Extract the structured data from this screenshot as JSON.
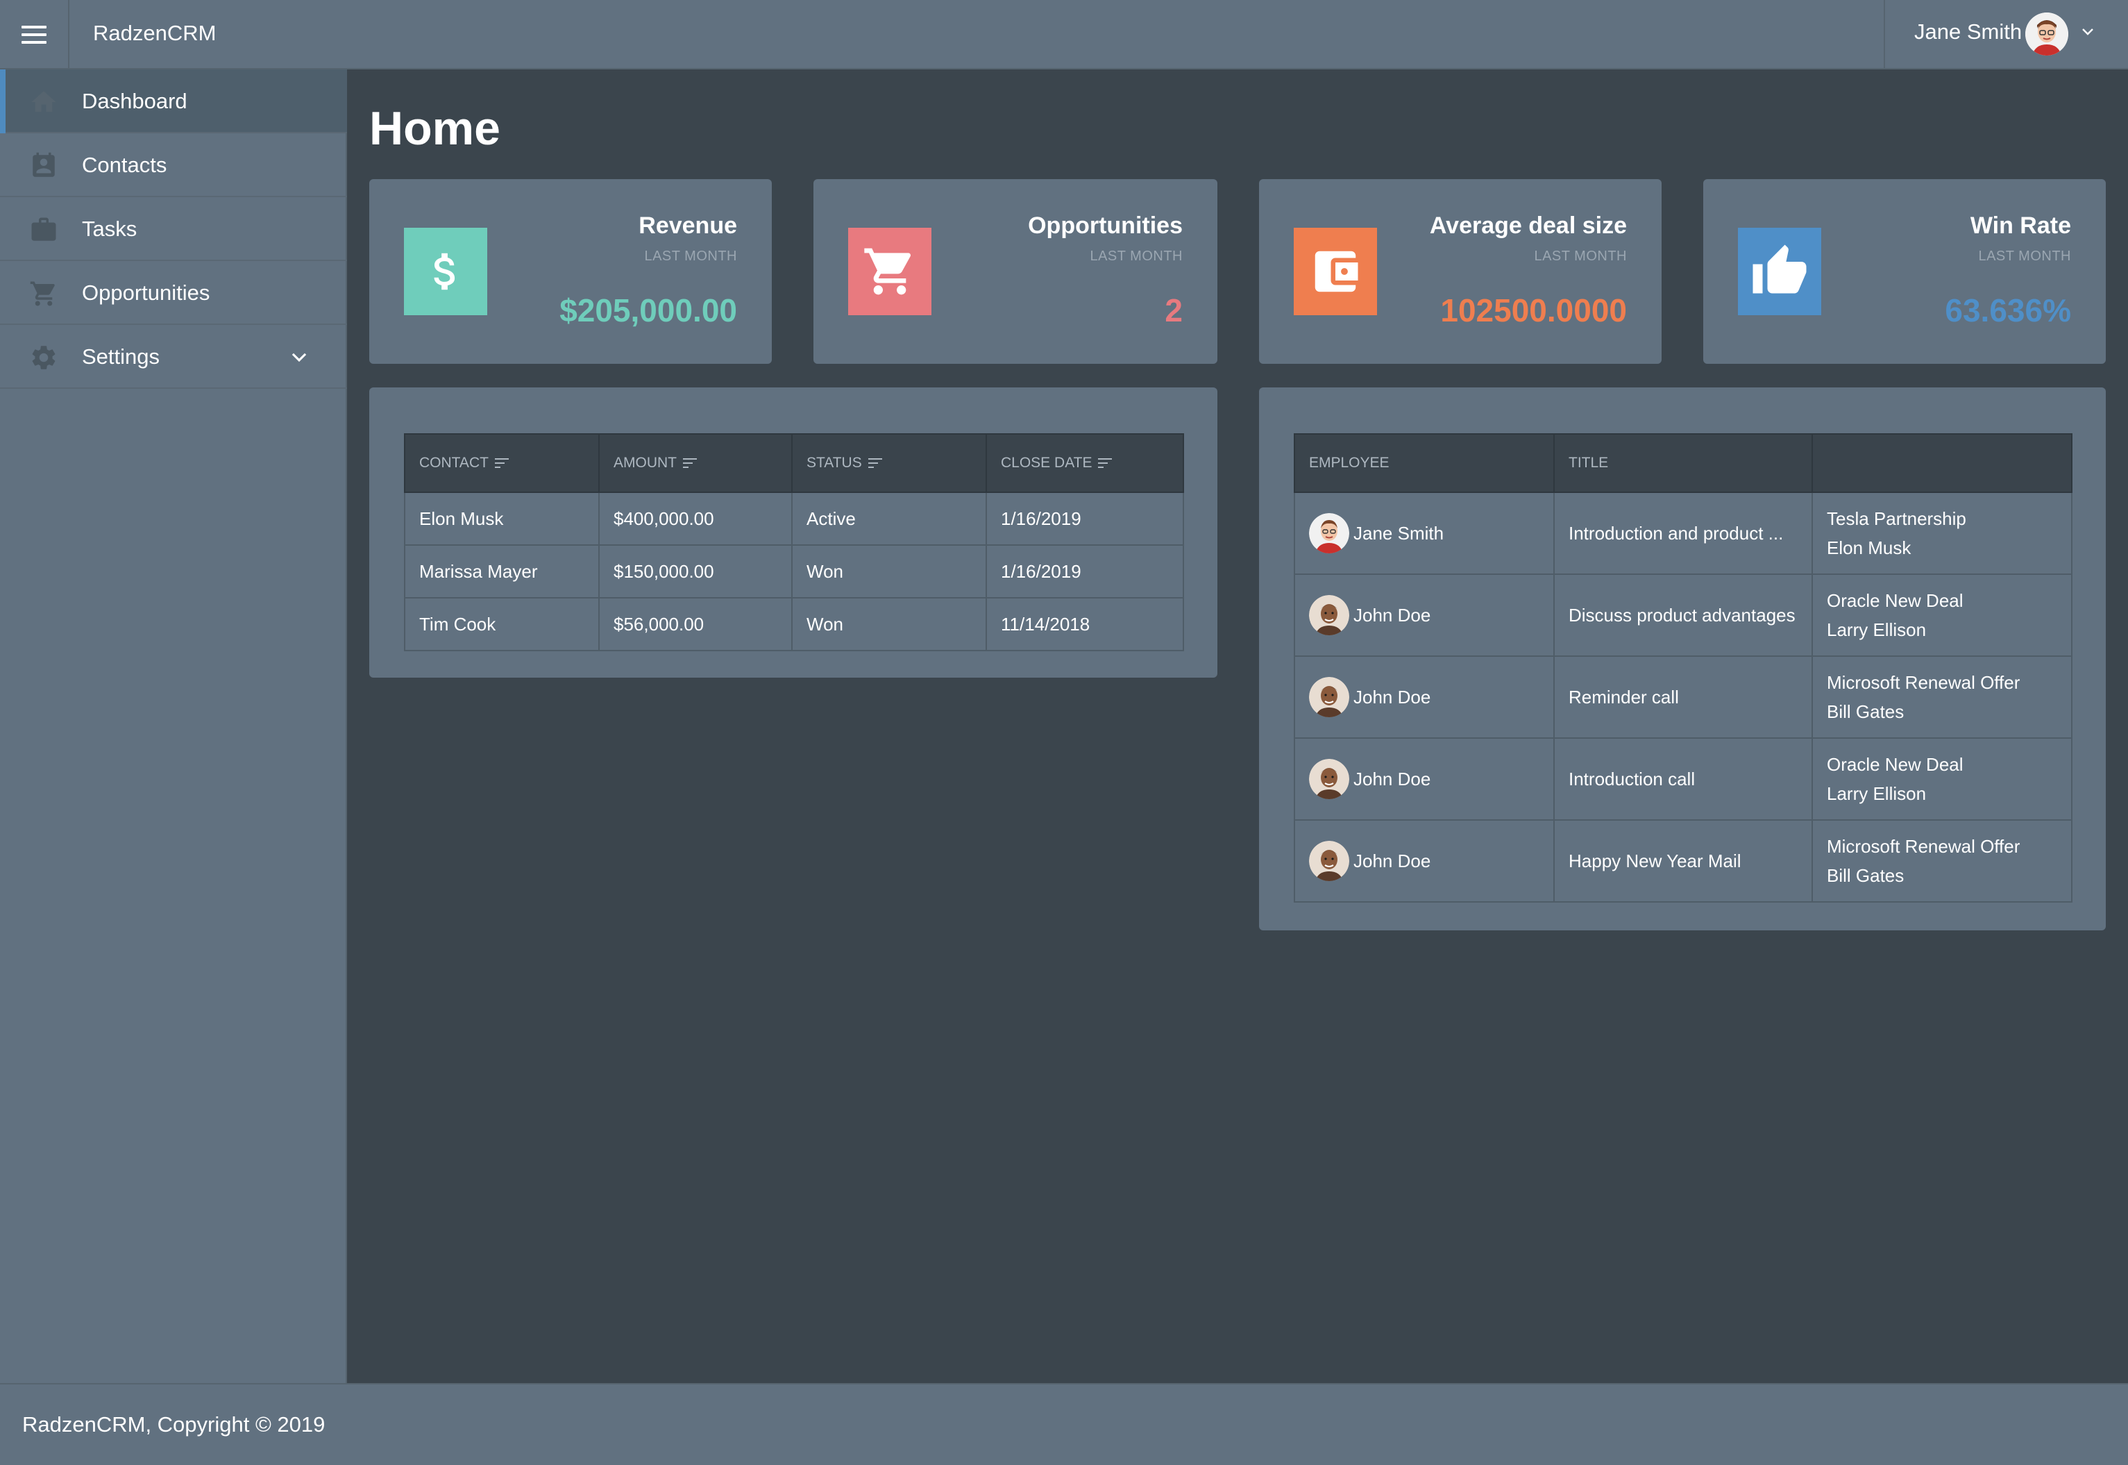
{
  "header": {
    "brand": "RadzenCRM",
    "user_name": "Jane Smith"
  },
  "sidebar": {
    "items": [
      {
        "label": "Dashboard",
        "icon": "home-icon",
        "active": true
      },
      {
        "label": "Contacts",
        "icon": "contacts-icon"
      },
      {
        "label": "Tasks",
        "icon": "briefcase-icon"
      },
      {
        "label": "Opportunities",
        "icon": "cart-icon"
      },
      {
        "label": "Settings",
        "icon": "gear-icon",
        "expandable": true
      }
    ]
  },
  "page": {
    "title": "Home"
  },
  "cards": [
    {
      "title": "Revenue",
      "subtitle": "LAST MONTH",
      "value": "$205,000.00",
      "color": "#6fcdbb",
      "icon": "dollar-icon"
    },
    {
      "title": "Opportunities",
      "subtitle": "LAST MONTH",
      "value": "2",
      "color": "#e87a7f",
      "icon": "cart-icon"
    },
    {
      "title": "Average deal size",
      "subtitle": "LAST MONTH",
      "value": "102500.0000",
      "color": "#ef7e4f",
      "icon": "wallet-icon"
    },
    {
      "title": "Win Rate",
      "subtitle": "LAST MONTH",
      "value": "63.636%",
      "color": "#4f8fc8",
      "icon": "thumbs-up-icon"
    }
  ],
  "opportunities_table": {
    "columns": [
      "CONTACT",
      "AMOUNT",
      "STATUS",
      "CLOSE DATE"
    ],
    "rows": [
      {
        "contact": "Elon Musk",
        "amount": "$400,000.00",
        "status": "Active",
        "close_date": "1/16/2019"
      },
      {
        "contact": "Marissa Mayer",
        "amount": "$150,000.00",
        "status": "Won",
        "close_date": "1/16/2019"
      },
      {
        "contact": "Tim Cook",
        "amount": "$56,000.00",
        "status": "Won",
        "close_date": "11/14/2018"
      }
    ]
  },
  "tasks_table": {
    "columns": [
      "EMPLOYEE",
      "TITLE",
      ""
    ],
    "rows": [
      {
        "employee": "Jane Smith",
        "avatar": "jane",
        "title": "Introduction and product ...",
        "opportunity": "Tesla Partnership",
        "contact": "Elon Musk"
      },
      {
        "employee": "John Doe",
        "avatar": "john",
        "title": "Discuss product advantages",
        "opportunity": "Oracle New Deal",
        "contact": "Larry Ellison"
      },
      {
        "employee": "John Doe",
        "avatar": "john",
        "title": "Reminder call",
        "opportunity": "Microsoft Renewal Offer",
        "contact": "Bill Gates"
      },
      {
        "employee": "John Doe",
        "avatar": "john",
        "title": "Introduction call",
        "opportunity": "Oracle New Deal",
        "contact": "Larry Ellison"
      },
      {
        "employee": "John Doe",
        "avatar": "john",
        "title": "Happy New Year Mail",
        "opportunity": "Microsoft Renewal Offer",
        "contact": "Bill Gates"
      }
    ]
  },
  "footer": {
    "text": "RadzenCRM, Copyright © 2019"
  }
}
